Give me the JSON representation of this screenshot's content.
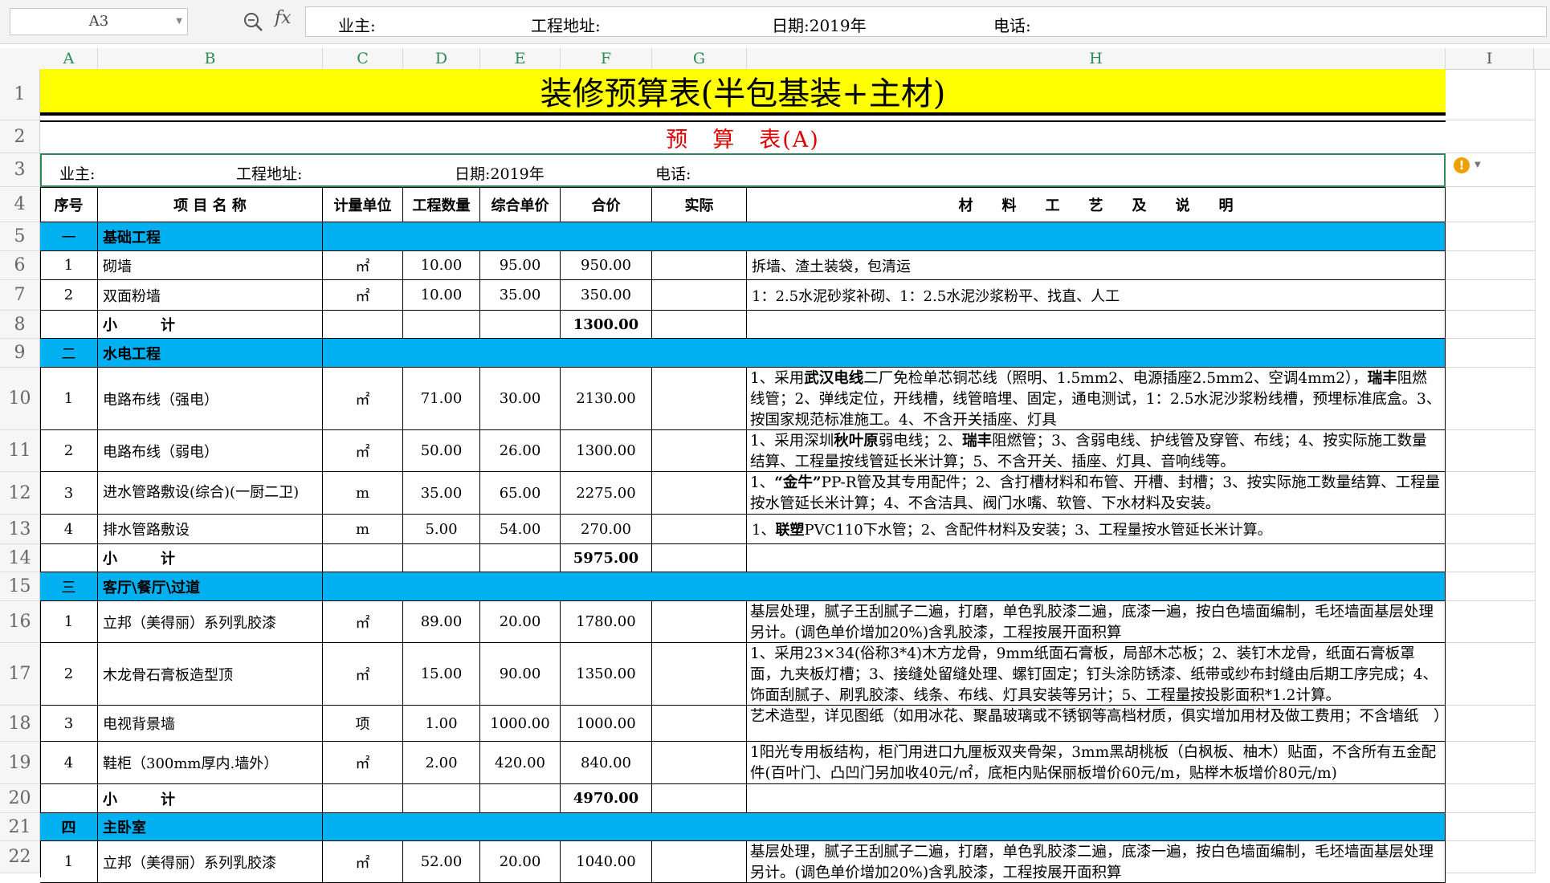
{
  "formula_bar": {
    "name_box": "A3",
    "fx_label": "fx",
    "owner": "业主:",
    "address": "工程地址:",
    "date": "日期:2019年",
    "phone": "电话:"
  },
  "columns": [
    "A",
    "B",
    "C",
    "D",
    "E",
    "F",
    "G",
    "H",
    "I"
  ],
  "rows_numbers": [
    "1",
    "2",
    "3",
    "4",
    "5",
    "6",
    "7",
    "8",
    "9",
    "10",
    "11",
    "12",
    "13",
    "14",
    "15",
    "16",
    "17",
    "18",
    "19",
    "20",
    "21",
    "22"
  ],
  "sheet": {
    "title": "装修预算表(半包基装+主材)",
    "subtitle": "预　算　表(A)",
    "owner": "业主:",
    "address": "工程地址:",
    "date": "日期:2019年",
    "phone": "电话:",
    "headers": {
      "no": "序号",
      "name": "项 目 名 称",
      "unit": "计量单位",
      "qty": "工程数量",
      "price": "综合单价",
      "total": "合价",
      "actual": "实际",
      "desc": "材　　料　　工　　艺　　及　　说　　明"
    },
    "sections": {
      "s1": {
        "no": "一",
        "name": "基础工程"
      },
      "s2": {
        "no": "二",
        "name": "水电工程"
      },
      "s3": {
        "no": "三",
        "name": "客厅\\餐厅\\过道"
      },
      "s4": {
        "no": "四",
        "name": "主卧室"
      }
    },
    "subtotal_label": "小　　　计",
    "items": {
      "r6": {
        "no": "1",
        "name": "砌墙",
        "unit": "㎡",
        "qty": "10.00",
        "price": "95.00",
        "total": "950.00",
        "desc": "拆墙、渣土装袋，包清运"
      },
      "r7": {
        "no": "2",
        "name": "双面粉墙",
        "unit": "㎡",
        "qty": "10.00",
        "price": "35.00",
        "total": "350.00",
        "desc": "1：2.5水泥砂浆补砌、1：2.5水泥沙浆粉平、找直、人工"
      },
      "r8": {
        "total": "1300.00"
      },
      "r10": {
        "no": "1",
        "name": "电路布线（强电）",
        "unit": "㎡",
        "qty": "71.00",
        "price": "30.00",
        "total": "2130.00",
        "desc_a": "1、采用",
        "desc_b": "武汉电线",
        "desc_c": "二厂免检单芯铜芯线（照明、1.5mm2、电源插座2.5mm2、空调4mm2），",
        "desc_d": "瑞丰",
        "desc_e": "阻燃线管；2、弹线定位，开线槽，线管暗埋、固定，通电测试，1：2.5水泥沙浆粉线槽，预埋标准底盒。3、按国家规范标准施工。4、不含开关插座、灯具"
      },
      "r11": {
        "no": "2",
        "name": "电路布线（弱电）",
        "unit": "㎡",
        "qty": "50.00",
        "price": "26.00",
        "total": "1300.00",
        "desc_a": "1、采用深圳",
        "desc_b": "秋叶原",
        "desc_c": "弱电线；2、",
        "desc_d": "瑞丰",
        "desc_e": "阻燃管；3、含弱电线、护线管及穿管、布线；4、按实际施工数量结算、工程量按线管延长米计算；5、不含开关、插座、灯具、音响线等。"
      },
      "r12": {
        "no": "3",
        "name": "进水管路敷设(综合)(一厨二卫)",
        "unit": "m",
        "qty": "35.00",
        "price": "65.00",
        "total": "2275.00",
        "desc_a": "1、",
        "desc_b": "“金牛”",
        "desc_c": "PP-R管及其专用配件；2、含打槽材料和布管、开槽、封槽；3、按实际施工数量结算、工程量按水管延长米计算；4、不含洁具、阀门水嘴、软管、下水材料及安装。"
      },
      "r13": {
        "no": "4",
        "name": "排水管路敷设",
        "unit": "m",
        "qty": "5.00",
        "price": "54.00",
        "total": "270.00",
        "desc_a": "1、",
        "desc_b": "联塑",
        "desc_c": "PVC110下水管；2、含配件材料及安装；3、工程量按水管延长米计算。"
      },
      "r14": {
        "total": "5975.00"
      },
      "r16": {
        "no": "1",
        "name": "立邦（美得丽）系列乳胶漆",
        "unit": "㎡",
        "qty": "89.00",
        "price": "20.00",
        "total": "1780.00",
        "desc": "基层处理，腻子王刮腻子二遍，打磨，单色乳胶漆二遍，底漆一遍，按白色墙面编制，毛坯墙面基层处理另计。(调色单价增加20%)含乳胶漆，工程按展开面积算"
      },
      "r17": {
        "no": "2",
        "name": "木龙骨石膏板造型顶",
        "unit": "㎡",
        "qty": "15.00",
        "price": "90.00",
        "total": "1350.00",
        "desc": "1、采用23×34(俗称3*4)木方龙骨，9mm纸面石膏板，局部木芯板；2、装钉木龙骨，纸面石膏板罩面，九夹板灯槽；3、接缝处留缝处理、螺钉固定；钉头涂防锈漆、纸带或纱布封缝由后期工序完成；4、饰面刮腻子、刷乳胶漆、线条、布线、灯具安装等另计；5、工程量按投影面积*1.2计算。"
      },
      "r18": {
        "no": "3",
        "name": "电视背景墙",
        "unit": "项",
        "qty": "1.00",
        "price": "1000.00",
        "total": "1000.00",
        "desc": "艺术造型，详见图纸（如用冰花、聚晶玻璃或不锈钢等高档材质，俱实增加用材及做工费用；不含墙纸　）"
      },
      "r19": {
        "no": "4",
        "name": "鞋柜（300mm厚内.墙外）",
        "unit": "㎡",
        "qty": "2.00",
        "price": "420.00",
        "total": "840.00",
        "desc": "1阳光专用板结构，柜门用进口九厘板双夹骨架，3mm黑胡桃板（白枫板、柚木）贴面，不含所有五金配件(百叶门、凸凹门另加收40元/㎡，底柜内贴保丽板增价60元/m，贴榉木板增价80元/m)"
      },
      "r20": {
        "total": "4970.00"
      },
      "r22": {
        "no": "1",
        "name": "立邦（美得丽）系列乳胶漆",
        "unit": "㎡",
        "qty": "52.00",
        "price": "20.00",
        "total": "1040.00",
        "desc": "基层处理，腻子王刮腻子二遍，打磨，单色乳胶漆二遍，底漆一遍，按白色墙面编制，毛坯墙面基层处理另计。(调色单价增加20%)含乳胶漆，工程按展开面积算"
      }
    }
  },
  "colors": {
    "section_fill": "#00b0f0",
    "title_fill": "#ffff00",
    "subtitle_text": "#e00000",
    "selection": "#2e8b57"
  }
}
